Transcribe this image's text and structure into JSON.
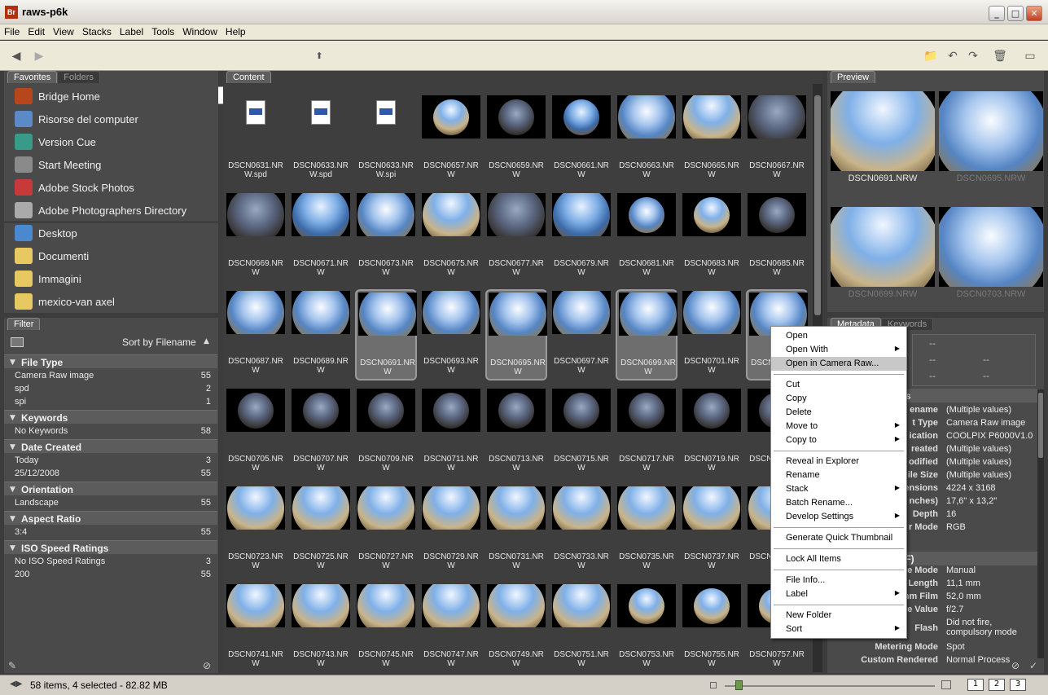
{
  "window": {
    "title": "raws-p6k",
    "app_icon": "Br"
  },
  "menu": [
    "File",
    "Edit",
    "View",
    "Stacks",
    "Label",
    "Tools",
    "Window",
    "Help"
  ],
  "toolbar": {
    "path": "raws-p6k"
  },
  "left_tabs": {
    "favorites": "Favorites",
    "folders": "Folders"
  },
  "favorites": [
    {
      "label": "Bridge Home",
      "icon": "bridge-home-icon",
      "color": "#b8461c"
    },
    {
      "label": "Risorse del computer",
      "icon": "computer-icon",
      "color": "#5a8ac8"
    },
    {
      "label": "Version Cue",
      "icon": "version-cue-icon",
      "color": "#3a9a8a"
    },
    {
      "label": "Start Meeting",
      "icon": "meeting-icon",
      "color": "#8a8a8a"
    },
    {
      "label": "Adobe Stock Photos",
      "icon": "stock-photos-icon",
      "color": "#c83a3a"
    },
    {
      "label": "Adobe Photographers Directory",
      "icon": "photographers-icon",
      "color": "#aaaaaa"
    },
    {
      "label": "Desktop",
      "icon": "desktop-icon",
      "color": "#4a88d0"
    },
    {
      "label": "Documenti",
      "icon": "folder-icon",
      "color": "#e8c860"
    },
    {
      "label": "Immagini",
      "icon": "folder-icon",
      "color": "#e8c860"
    },
    {
      "label": "mexico-van axel",
      "icon": "folder-icon",
      "color": "#e8c860"
    }
  ],
  "filter": {
    "tab": "Filter",
    "sort_label": "Sort by Filename",
    "groups": [
      {
        "title": "File Type",
        "rows": [
          {
            "label": "Camera Raw image",
            "count": "55"
          },
          {
            "label": "spd",
            "count": "2"
          },
          {
            "label": "spi",
            "count": "1"
          }
        ]
      },
      {
        "title": "Keywords",
        "rows": [
          {
            "label": "No Keywords",
            "count": "58"
          }
        ]
      },
      {
        "title": "Date Created",
        "rows": [
          {
            "label": "Today",
            "count": "3"
          },
          {
            "label": "25/12/2008",
            "count": "55"
          }
        ]
      },
      {
        "title": "Orientation",
        "rows": [
          {
            "label": "Landscape",
            "count": "55"
          }
        ]
      },
      {
        "title": "Aspect Ratio",
        "rows": [
          {
            "label": "3:4",
            "count": "55"
          }
        ]
      },
      {
        "title": "ISO Speed Ratings",
        "rows": [
          {
            "label": "No ISO Speed Ratings",
            "count": "3"
          },
          {
            "label": "200",
            "count": "55"
          }
        ]
      }
    ]
  },
  "content": {
    "tab": "Content",
    "rows": [
      [
        "DSCN0631.NRW.spd",
        "DSCN0633.NRW.spd",
        "DSCN0633.NRW.spi",
        "DSCN0657.NRW",
        "DSCN0659.NRW",
        "DSCN0661.NRW",
        "DSCN0663.NRW",
        "DSCN0665.NRW",
        "DSCN0667.NRW"
      ],
      [
        "DSCN0669.NRW",
        "DSCN0671.NRW",
        "DSCN0673.NRW",
        "DSCN0675.NRW",
        "DSCN0677.NRW",
        "DSCN0679.NRW",
        "DSCN0681.NRW",
        "DSCN0683.NRW",
        "DSCN0685.NRW"
      ],
      [
        "DSCN0687.NRW",
        "DSCN0689.NRW",
        "DSCN0691.NRW",
        "DSCN0693.NRW",
        "DSCN0695.NRW",
        "DSCN0697.NRW",
        "DSCN0699.NRW",
        "DSCN0701.NRW",
        "DSCN0703.NRW"
      ],
      [
        "DSCN0705.NRW",
        "DSCN0707.NRW",
        "DSCN0709.NRW",
        "DSCN0711.NRW",
        "DSCN0713.NRW",
        "DSCN0715.NRW",
        "DSCN0717.NRW",
        "DSCN0719.NRW",
        "DSCN0721.NRW"
      ],
      [
        "DSCN0723.NRW",
        "DSCN0725.NRW",
        "DSCN0727.NRW",
        "DSCN0729.NRW",
        "DSCN0731.NRW",
        "DSCN0733.NRW",
        "DSCN0735.NRW",
        "DSCN0737.NRW",
        "DSCN0739.NRW"
      ],
      [
        "DSCN0741.NRW",
        "DSCN0743.NRW",
        "DSCN0745.NRW",
        "DSCN0747.NRW",
        "DSCN0749.NRW",
        "DSCN0751.NRW",
        "DSCN0753.NRW",
        "DSCN0755.NRW",
        "DSCN0757.NRW"
      ]
    ],
    "selected": [
      "DSCN0691.NRW",
      "DSCN0695.NRW",
      "DSCN0699.NRW",
      "DSCN0703.NRW"
    ]
  },
  "preview": {
    "tab": "Preview",
    "items": [
      {
        "label": "DSCN0691.NRW",
        "active": true
      },
      {
        "label": "DSCN0695.NRW",
        "active": false
      },
      {
        "label": "DSCN0699.NRW",
        "active": false
      },
      {
        "label": "DSCN0703.NRW",
        "active": false
      }
    ]
  },
  "meta_tabs": {
    "metadata": "Metadata",
    "keywords": "Keywords"
  },
  "context_menu": [
    {
      "label": "Open"
    },
    {
      "label": "Open With",
      "sub": true
    },
    {
      "label": "Open in Camera Raw...",
      "hl": true
    },
    {
      "sep": true
    },
    {
      "label": "Cut"
    },
    {
      "label": "Copy"
    },
    {
      "label": "Delete"
    },
    {
      "label": "Move to",
      "sub": true
    },
    {
      "label": "Copy to",
      "sub": true
    },
    {
      "sep": true
    },
    {
      "label": "Reveal in Explorer"
    },
    {
      "label": "Rename"
    },
    {
      "label": "Stack",
      "sub": true
    },
    {
      "label": "Batch Rename..."
    },
    {
      "label": "Develop Settings",
      "sub": true
    },
    {
      "sep": true
    },
    {
      "label": "Generate Quick Thumbnail"
    },
    {
      "sep": true
    },
    {
      "label": "Lock All Items"
    },
    {
      "sep": true
    },
    {
      "label": "File Info..."
    },
    {
      "label": "Label",
      "sub": true
    },
    {
      "sep": true
    },
    {
      "label": "New Folder"
    },
    {
      "label": "Sort",
      "sub": true
    }
  ],
  "metadata": {
    "placard": [
      "--",
      "--",
      "--",
      "--",
      "--"
    ],
    "file_props_header": "s",
    "file_props": [
      {
        "k": "ename",
        "v": "(Multiple values)"
      },
      {
        "k": "t Type",
        "v": "Camera Raw image"
      },
      {
        "k": "ication",
        "v": "COOLPIX P6000V1.0"
      },
      {
        "k": "reated",
        "v": "(Multiple values)"
      },
      {
        "k": "odified",
        "v": "(Multiple values)"
      },
      {
        "k": "ile Size",
        "v": "(Multiple values)"
      },
      {
        "k": "ensions",
        "v": "4224 x 3168"
      },
      {
        "k": "nches)",
        "v": "17,6\" x 13,2\""
      },
      {
        "k": "Depth",
        "v": "16"
      },
      {
        "k": "r Mode",
        "v": "RGB"
      }
    ],
    "exif_header": "(EXIF)",
    "exif": [
      {
        "k": "e Mode",
        "v": "Manual"
      },
      {
        "k": "Length",
        "v": "11,1 mm"
      },
      {
        "k": "35mm Film",
        "v": "52,0 mm"
      },
      {
        "k": "e Value",
        "v": "f/2.7"
      },
      {
        "k": "Flash",
        "v": "Did not fire, compulsory mode"
      },
      {
        "k": "Metering Mode",
        "v": "Spot"
      },
      {
        "k": "Custom Rendered",
        "v": "Normal Process"
      }
    ]
  },
  "status": {
    "text": "58 items, 4 selected - 82.82 MB",
    "view_buttons": [
      "1",
      "2",
      "3"
    ]
  }
}
